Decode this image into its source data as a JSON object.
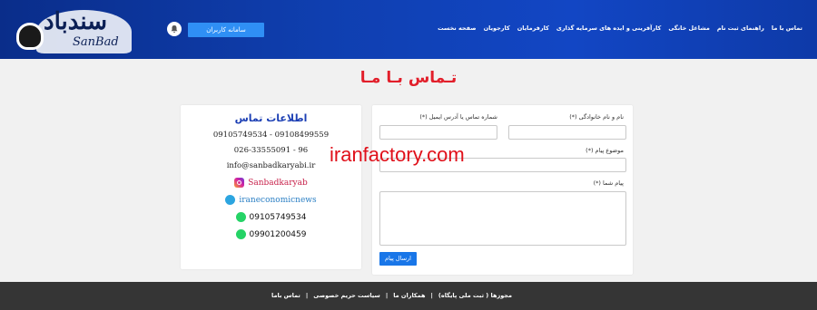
{
  "header": {
    "logo_text": "سندباد",
    "logo_sub": "SanBad",
    "login_label": "سامانه کاربران",
    "nav": [
      "صفحه نخست",
      "کارجویان",
      "کارفرمایان",
      "کارآفرینی و ایده های سرمایه گذاری",
      "مشاغل خانگی",
      "راهنمای ثبت نام",
      "تماس با ما"
    ]
  },
  "page": {
    "title": "تـماس بـا مـا"
  },
  "contact_info": {
    "title": "اطلاعات تماس",
    "phones_mobile": "09105749534 - 09108499559",
    "phone_landline": "026-33555091 - 96",
    "email": "info@sanbadkaryabi.ir",
    "instagram": "Sanbadkaryab",
    "telegram": "iraneconomicnews",
    "whatsapp_1": "09105749534",
    "whatsapp_2": "09901200459"
  },
  "form": {
    "name_label": "نام و نام خانوادگی (*)",
    "phone_label": "شماره تماس یا آدرس ایمیل (*)",
    "subject_label": "موضوع پیام (*)",
    "message_label": "پیام شما (*)",
    "name_value": "",
    "phone_value": "",
    "subject_value": "",
    "message_value": "",
    "submit_label": "ارسال پیام"
  },
  "watermark": "iranfactory.com",
  "footer": {
    "links": [
      "تماس باما",
      "سیاست حریم خصوصی",
      "همکاران ما",
      "مجوزها ( ثبت ملی پایگاه)"
    ],
    "separator": "|"
  },
  "colors": {
    "header_blue": "#1246c4",
    "title_red": "#e21f2b",
    "button_blue": "#2f8ff5",
    "footer_dark": "#353535"
  }
}
